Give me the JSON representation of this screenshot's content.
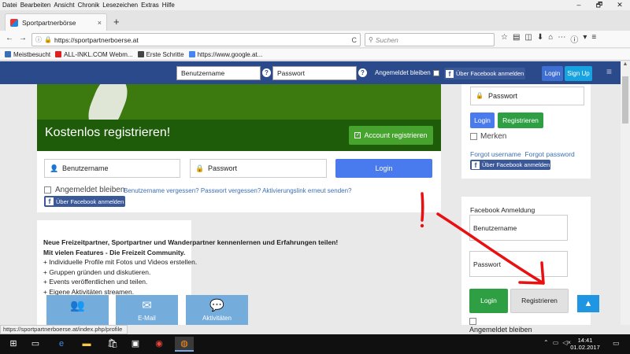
{
  "menu": [
    "Datei",
    "Bearbeiten",
    "Ansicht",
    "Chronik",
    "Lesezeichen",
    "Extras",
    "Hilfe"
  ],
  "window_controls": [
    "–",
    "🗗",
    "✕"
  ],
  "tab": {
    "title": "Sportpartnerbörse",
    "close": "×",
    "new": "+"
  },
  "nav": {
    "back": "←",
    "forward": "→",
    "info": "ⓘ",
    "url": "https://sportpartnerboerse.at",
    "reload": "C",
    "search_placeholder": "Suchen"
  },
  "toolbar_icons": [
    "☆",
    "▤",
    "◫",
    "⬇",
    "⌂",
    "⋯",
    "ⓘ",
    "▾",
    "≡"
  ],
  "bookmarks": [
    {
      "label": "Meistbesucht",
      "color": "#3b6fb5"
    },
    {
      "label": "ALL-INKL.COM Webm...",
      "color": "#e02020"
    },
    {
      "label": "Erste Schritte",
      "color": "#444444"
    },
    {
      "label": "https://www.google.at...",
      "color": "#4285f4"
    }
  ],
  "header": {
    "username_placeholder": "Benutzername",
    "password_placeholder": "Passwort",
    "help": "?",
    "stay_logged_in": "Angemeldet bleiben",
    "fb_login": "Über Facebook anmelden",
    "login": "Login",
    "signup": "Sign Up",
    "menu": "≡"
  },
  "main": {
    "register_title": "Kostenlos registrieren!",
    "register_button": "Account registrieren",
    "username_placeholder": "Benutzername",
    "password_placeholder": "Passwort",
    "login_button": "Login",
    "stay_logged_in": "Angemeldet bleiben",
    "forgot_links": "Benutzername vergessen? Passwort vergessen? Aktivierungslink erneut senden?",
    "fb_login": "Über Facebook anmelden"
  },
  "info": {
    "headline": "Neue Freizeitpartner, Sportpartner und Wanderpartner kennenlernen und Erfahrungen teilen!",
    "subline": "Mit vielen Features - Die Freizeit Community.",
    "features": [
      "+ Individuelle Profile mit Fotos und Videos erstellen.",
      "+ Gruppen gründen und diskutieren.",
      "+ Events veröffentlichen und teilen.",
      "+ Eigene Aktivitäten streamen."
    ],
    "tiles": [
      {
        "icon": "👥",
        "label": ""
      },
      {
        "icon": "✉",
        "label": "E-Mail"
      },
      {
        "icon": "💬",
        "label": "Aktivitäten"
      }
    ]
  },
  "right_panel": {
    "password_placeholder": "Passwort",
    "login": "Login",
    "register": "Registrieren",
    "remember": "Merken",
    "forgot": "Forgot username  Forgot password",
    "fb_login": "Über Facebook anmelden"
  },
  "fb_panel": {
    "heading": "Facebook Anmeldung",
    "username": "Benutzername",
    "password": "Passwort",
    "login": "Login",
    "register": "Registrieren",
    "stay": "Angemeldet bleiben"
  },
  "back_to_top": "▲",
  "status_url": "https://sportpartnerboerse.at/index.php/profile",
  "taskbar": {
    "time": "14:41",
    "date": "01.02.2017",
    "tray": [
      "⌃",
      "▭",
      "◁×"
    ],
    "notif": "▭"
  },
  "annotation": {
    "mark": "!",
    "color": "#e81010"
  }
}
